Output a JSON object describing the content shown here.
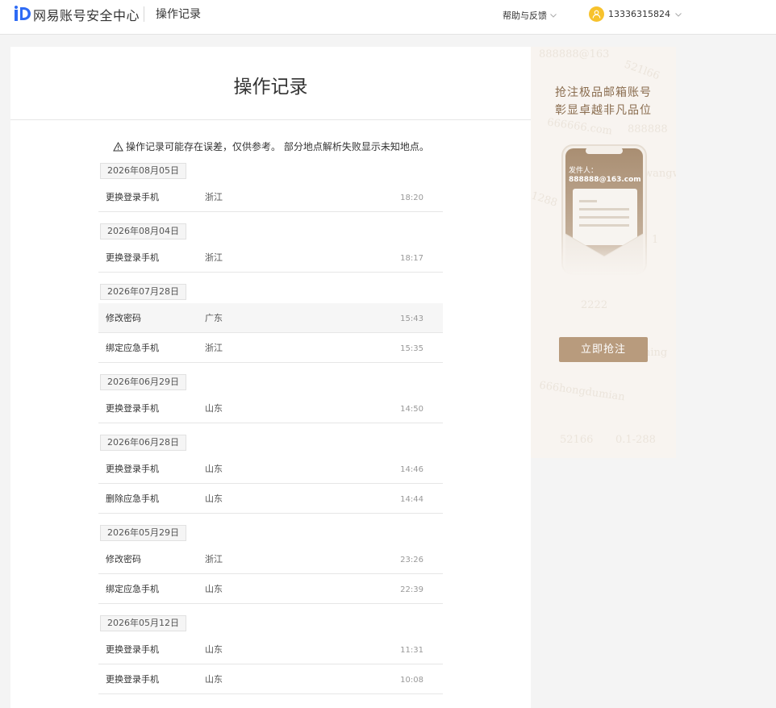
{
  "header": {
    "brand": "网易账号安全中心",
    "page": "操作记录",
    "help": "帮助与反馈",
    "user": "13336315824"
  },
  "main": {
    "title": "操作记录",
    "notice": "操作记录可能存在误差，仅供参考。 部分地点解析失败显示未知地点。",
    "groups": [
      {
        "date": "2026年08月05日",
        "rows": [
          {
            "op": "更换登录手机",
            "loc": "浙江",
            "time": "18:20"
          }
        ]
      },
      {
        "date": "2026年08月04日",
        "rows": [
          {
            "op": "更换登录手机",
            "loc": "浙江",
            "time": "18:17"
          }
        ]
      },
      {
        "date": "2026年07月28日",
        "rows": [
          {
            "op": "修改密码",
            "loc": "广东",
            "time": "15:43"
          },
          {
            "op": "绑定应急手机",
            "loc": "浙江",
            "time": "15:35"
          }
        ]
      },
      {
        "date": "2026年06月29日",
        "rows": [
          {
            "op": "更换登录手机",
            "loc": "山东",
            "time": "14:50"
          }
        ]
      },
      {
        "date": "2026年06月28日",
        "rows": [
          {
            "op": "更换登录手机",
            "loc": "山东",
            "time": "14:46"
          },
          {
            "op": "删除应急手机",
            "loc": "山东",
            "time": "14:44"
          }
        ]
      },
      {
        "date": "2026年05月29日",
        "rows": [
          {
            "op": "修改密码",
            "loc": "浙江",
            "time": "23:26"
          },
          {
            "op": "绑定应急手机",
            "loc": "山东",
            "time": "22:39"
          }
        ]
      },
      {
        "date": "2026年05月12日",
        "rows": [
          {
            "op": "更换登录手机",
            "loc": "山东",
            "time": "11:31"
          },
          {
            "op": "更换登录手机",
            "loc": "山东",
            "time": "10:08"
          }
        ]
      }
    ]
  },
  "ad": {
    "title_line1": "抢注极品邮箱账号",
    "title_line2": "彰显卓越非凡品位",
    "sender_label": "发件人：",
    "sender_email": "888888@163.com",
    "button": "立即抢注"
  },
  "colors": {
    "brand_blue": "#2f6cf5",
    "avatar_yellow": "#f7c22c",
    "ad_gold": "#b89b7d"
  }
}
